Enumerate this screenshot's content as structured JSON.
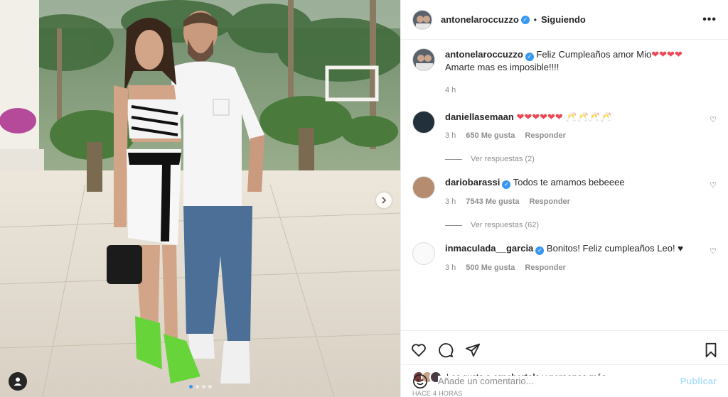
{
  "post": {
    "author": "antonelaroccuzzo",
    "follow_status": "Siguiendo",
    "separator": "•",
    "more_label": "•••"
  },
  "caption": {
    "user": "antonelaroccuzzo",
    "text": "Feliz Cumpleaños amor Mio",
    "emoji": "❤❤❤❤",
    "text2": "Amarte mas es imposible!!!!",
    "time": "4 h"
  },
  "comments": [
    {
      "user": "daniellasemaan",
      "verified": false,
      "text": "❤❤❤❤❤❤ 🥂🥂🥂🥂",
      "time": "3 h",
      "likes": "650 Me gusta",
      "reply": "Responder",
      "replies": "Ver respuestas (2)"
    },
    {
      "user": "dariobarassi",
      "verified": true,
      "text": "Todos te amamos bebeeee",
      "time": "3 h",
      "likes": "7543 Me gusta",
      "reply": "Responder",
      "replies": "Ver respuestas (62)"
    },
    {
      "user": "inmaculada__garcia",
      "verified": true,
      "text": "Bonitos! Feliz cumpleaños Leo! ♥",
      "time": "3 h",
      "likes": "500 Me gusta",
      "reply": "Responder"
    }
  ],
  "likes": {
    "prefix": "Les gusta a",
    "user": "ornebertola",
    "suffix": "y",
    "others": "personas más"
  },
  "posted_ago": "HACE 4 HORAS",
  "add_comment": {
    "placeholder": "Añade un comentario...",
    "publish": "Publicar"
  },
  "icons": {
    "like": "heart-icon",
    "comment": "comment-icon",
    "share": "share-icon",
    "save": "bookmark-icon",
    "emoji": "smiley-icon",
    "next": "chevron-right-icon",
    "tag": "user-tag-icon"
  },
  "colors": {
    "verified": "#3897f0",
    "publish_disabled": "#b2dffc",
    "heart": "#ed4956"
  }
}
